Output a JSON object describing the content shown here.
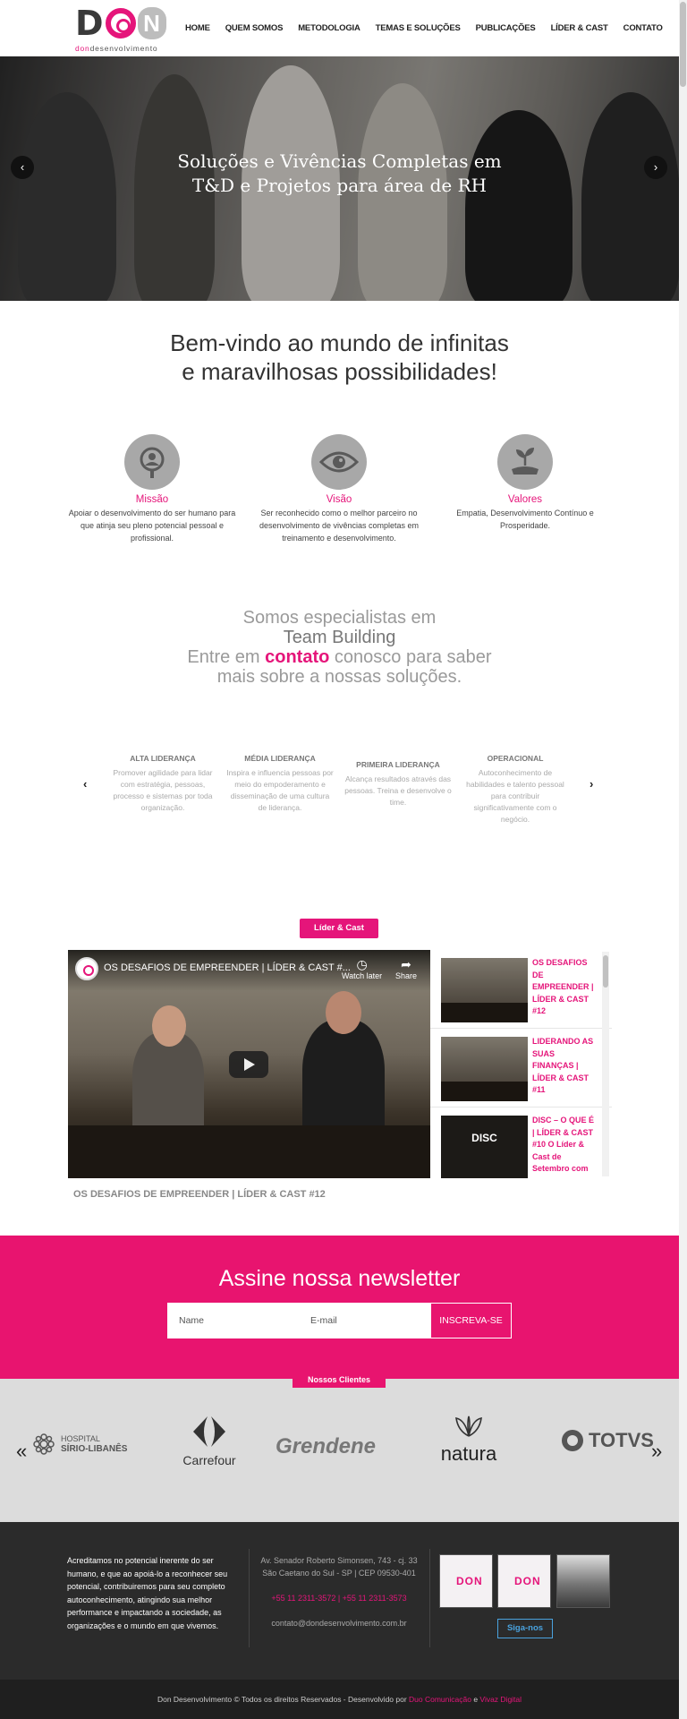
{
  "header": {
    "logo_tag_a": "don",
    "logo_tag_b": "desenvolvimento",
    "nav": [
      "HOME",
      "QUEM SOMOS",
      "METODOLOGIA",
      "TEMAS E SOLUÇÕES",
      "PUBLICAÇÕES",
      "LÍDER & CAST",
      "CONTATO"
    ]
  },
  "hero": {
    "title_line1": "Soluções e Vivências Completas em",
    "title_line2": "T&D e Projetos para área de RH",
    "prev": "‹",
    "next": "›"
  },
  "welcome": {
    "line1": "Bem-vindo ao mundo de infinitas",
    "line2": "e maravilhosas possibilidades!"
  },
  "features": [
    {
      "title": "Missão",
      "text": "Apoiar o desenvolvimento do ser humano para que atinja seu pleno potencial pessoal e profissional.",
      "icon": "magnifier-person-icon"
    },
    {
      "title": "Visão",
      "text": "Ser reconhecido como o melhor parceiro no desenvolvimento de vivências completas em treinamento e desenvolvimento.",
      "icon": "eye-icon"
    },
    {
      "title": "Valores",
      "text": "Empatia, Desenvolvimento Contínuo e Prosperidade.",
      "icon": "hand-plant-icon"
    }
  ],
  "specialists": {
    "line1": "Somos especialistas em",
    "line2": "Team Building",
    "line3_a": "Entre em ",
    "line3_link": "contato",
    "line3_b": " conosco para saber",
    "line4": "mais sobre a nossas soluções."
  },
  "levels": [
    {
      "title": "ALTA LIDERANÇA",
      "text": "Promover agilidade para lidar com estratégia, pessoas, processo e sistemas por toda organização."
    },
    {
      "title": "MÉDIA LIDERANÇA",
      "text": "Inspira e influencia pessoas por meio do empoderamento e disseminação de uma cultura de liderança."
    },
    {
      "title": "PRIMEIRA LIDERANÇA",
      "text": "Alcança resultados através das pessoas. Treina e desenvolve o time."
    },
    {
      "title": "OPERACIONAL",
      "text": "Autoconhecimento de habilidades e talento pessoal para contribuir significativamente com o negócio."
    }
  ],
  "levels_nav": {
    "prev": "‹",
    "next": "›"
  },
  "lider_cast": {
    "button": "Líder & Cast",
    "video_title": "OS DESAFIOS DE EMPREENDER | LÍDER & CAST #...",
    "watch_later": "Watch later",
    "share": "Share",
    "caption": "OS DESAFIOS DE EMPREENDER | LÍDER & CAST #12",
    "playlist": [
      {
        "title": "OS DESAFIOS DE EMPREENDER | LÍDER & CAST #12"
      },
      {
        "title": "LIDERANDO AS SUAS FINANÇAS | LÍDER & CAST #11"
      },
      {
        "title": "DISC – O QUE É | LÍDER & CAST #10 O Líder & Cast de Setembro com",
        "thumb_text": "DISC"
      }
    ]
  },
  "newsletter": {
    "title": "Assine nossa newsletter",
    "name_placeholder": "Name",
    "email_placeholder": "E-mail",
    "button": "INSCREVA-SE"
  },
  "clients": {
    "tag": "Nossos Clientes",
    "prev": "«",
    "next": "»",
    "logos": [
      "HOSPITAL SÍRIO-LIBANÊS",
      "Carrefour",
      "Grendene",
      "natura",
      "TOTVS"
    ],
    "hospital_a": "HOSPITAL",
    "hospital_b": "SÍRIO-LIBANÊS"
  },
  "footer": {
    "about": "Acreditamos no potencial inerente do ser humano, e que ao apoiá-lo a reconhecer seu potencial, contribuiremos para seu completo autoconhecimento, atingindo sua melhor performance e impactando a sociedade, as organizações e o mundo em que vivemos.",
    "address_line1": "Av. Senador Roberto Simonsen, 743 - cj. 33",
    "address_line2": "São Caetano do Sul - SP | CEP 09530-401",
    "phones": "+55 11 2311-3572 | +55 11 2311-3573",
    "email": "contato@dondesenvolvimento.com.br",
    "ig_mini": "DON",
    "follow": "Siga-nos"
  },
  "copyright": {
    "text": "Don Desenvolvimento © Todos os direitos Reservados - Desenvolvido por ",
    "agency1": "Duo Comunicação",
    "and": " e ",
    "agency2": "Vivaz Digital"
  },
  "colors": {
    "brand_pink": "#e8146f",
    "text_dark": "#333333",
    "footer_bg": "#2b2b2b"
  }
}
